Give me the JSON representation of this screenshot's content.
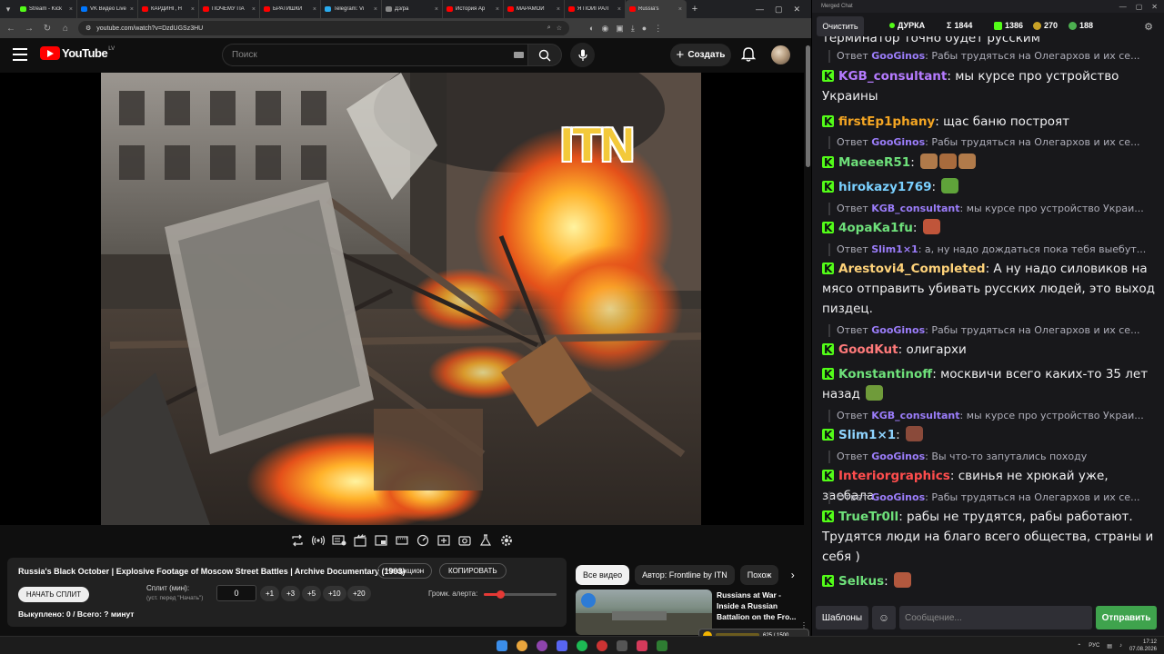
{
  "browser": {
    "tabs": [
      {
        "label": "Stream - Kick",
        "color": "#53fc18"
      },
      {
        "label": "VK Видео Live",
        "color": "#0077ff"
      },
      {
        "label": "КАРДИНГ, Н",
        "color": "#ff0000"
      },
      {
        "label": "ПОЧЕМУ ПА",
        "color": "#ff0000"
      },
      {
        "label": "БРАТИШКИ",
        "color": "#ff0000"
      },
      {
        "label": "Telegram: Vi",
        "color": "#2aabee"
      },
      {
        "label": "Дз/pa",
        "color": "#888888"
      },
      {
        "label": "История Ар",
        "color": "#ff0000"
      },
      {
        "label": "МАРАМОЙ",
        "color": "#ff0000"
      },
      {
        "label": "Я ПОИГРАЛ",
        "color": "#ff0000"
      },
      {
        "label": "Russia's",
        "color": "#ff0000",
        "active": true
      }
    ],
    "url": "youtube.com/watch?v=DzdUGSz3HU"
  },
  "youtube": {
    "logo_text": "YouTube",
    "country_code": "LV",
    "search_placeholder": "Поиск",
    "create_label": "Создать"
  },
  "video": {
    "watermark": "ITN"
  },
  "panel": {
    "title": "Russia's Black October | Explosive Footage of Moscow Street Battles | Archive Documentary (1993)",
    "auction_label": "На аукцион",
    "copy_label": "КОПИРОВАТЬ",
    "start_split_label": "НАЧАТЬ СПЛИТ",
    "split_label": "Сплит (мин):",
    "split_hint": "(уст. перед \"Начать\")",
    "split_value": "0",
    "split_steps": [
      "+1",
      "+3",
      "+5",
      "+10",
      "+20"
    ],
    "alert_volume_label": "Громк. алерта:",
    "alert_volume_fraction": 0.22,
    "bought_text": "Выкуплено: 0 / Всего: ? минут"
  },
  "related": {
    "chips": [
      "Все видео",
      "Автор: Frontline by ITN",
      "Похож"
    ],
    "item_title": "Russians at War - Inside a Russian Battalion on the Fro..."
  },
  "chat": {
    "window_title": "Merged Chat",
    "clear_label": "Очистить",
    "stats": [
      {
        "label": "ДУРКА",
        "color": "#53fc18"
      },
      {
        "label": "1844",
        "prefix": "Σ"
      },
      {
        "label": "1386",
        "color": "#53fc18"
      },
      {
        "label": "270",
        "color": "#c9a227"
      },
      {
        "label": "188",
        "color": "#4caf50"
      }
    ],
    "top_cut_text": "терминатор точно будет русским",
    "messages": [
      {
        "type": "reply",
        "user": "GooGinos",
        "text": "Рабы трудяться на Олегархов и их се..."
      },
      {
        "type": "msg",
        "user": "KGB_consultant",
        "color": "#b57bff",
        "text": "мы курсе про устройство Украины"
      },
      {
        "type": "msg",
        "user": "firstEp1phany",
        "color": "#f5a623",
        "text": "щас баню построят"
      },
      {
        "type": "reply",
        "user": "GooGinos",
        "text": "Рабы трудяться на Олегархов и их се..."
      },
      {
        "type": "msg",
        "user": "MaeeeR51",
        "color": "#6ee07a",
        "text": ""
      },
      {
        "type": "msg",
        "user": "hirokazy1769",
        "color": "#7ad0ff",
        "text": ""
      },
      {
        "type": "reply",
        "user": "KGB_consultant",
        "text": "мы курсе про устройство Украи..."
      },
      {
        "type": "msg",
        "user": "4opaKa1fu",
        "color": "#6ee07a",
        "text": ""
      },
      {
        "type": "reply",
        "user": "Slim1×1",
        "text": "а, ну надо дождаться пока тебя выебут..."
      },
      {
        "type": "msg",
        "user": "Arestovi4_Completed",
        "color": "#ffd37a",
        "text": "А ну надо силовиков на мясо отправить убивать русских людей, это выход пиздец."
      },
      {
        "type": "reply",
        "user": "GooGinos",
        "text": "Рабы трудяться на Олегархов и их се..."
      },
      {
        "type": "msg",
        "user": "GoodKut",
        "color": "#ff7a7a",
        "text": "олигархи"
      },
      {
        "type": "msg",
        "user": "Konstantinoff",
        "color": "#6ee07a",
        "text": "москвичи всего каких-то 35 лет назад"
      },
      {
        "type": "reply",
        "user": "KGB_consultant",
        "text": "мы курсе про устройство Украи..."
      },
      {
        "type": "msg",
        "user": "Slim1×1",
        "color": "#8fd4ff",
        "text": ""
      },
      {
        "type": "reply",
        "user": "GooGinos",
        "text": "Вы что-то запутались походу"
      },
      {
        "type": "msg",
        "user": "Interiorgraphics",
        "color": "#ff4d4d",
        "text": "свинья не хрюкай уже, заебала"
      },
      {
        "type": "reply",
        "user": "GooGinos",
        "text": "Рабы трудяться на Олегархов и их се..."
      },
      {
        "type": "msg",
        "user": "TrueTr0ll",
        "color": "#6ee07a",
        "text": "рабы не трудятся, рабы работают. Трудятся люди на благо всего общества, страны и себя )"
      },
      {
        "type": "msg",
        "user": "Selkus",
        "color": "#6ee07a",
        "text": ""
      }
    ],
    "templates_label": "Шаблоны",
    "input_placeholder": "Сообщение...",
    "send_label": "Отправить"
  },
  "taskbar": {
    "lang": "РУС",
    "time": "17:12",
    "date": "07.08.2026",
    "widget_text": "625 / 1500"
  }
}
